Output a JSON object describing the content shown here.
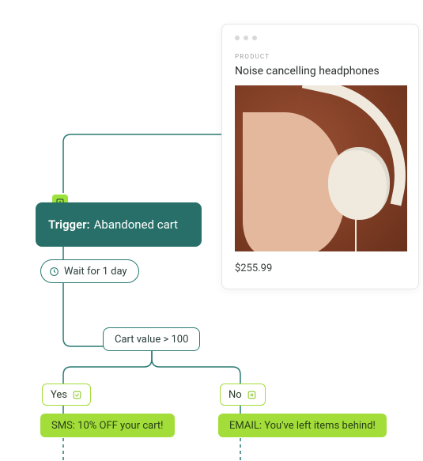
{
  "product": {
    "section_label": "PRODUCT",
    "name": "Noise cancelling headphones",
    "price": "$255.99"
  },
  "flow": {
    "trigger_prefix": "Trigger:",
    "trigger_event": "Abandoned cart",
    "wait_label": "Wait for 1 day",
    "condition_label": "Cart value > 100",
    "branches": {
      "yes_label": "Yes",
      "no_label": "No"
    },
    "actions": {
      "yes": "SMS: 10% OFF your cart!",
      "no": "EMAIL: You've left items behind!"
    }
  },
  "colors": {
    "teal": "#276f68",
    "lime": "#a3dd39"
  }
}
